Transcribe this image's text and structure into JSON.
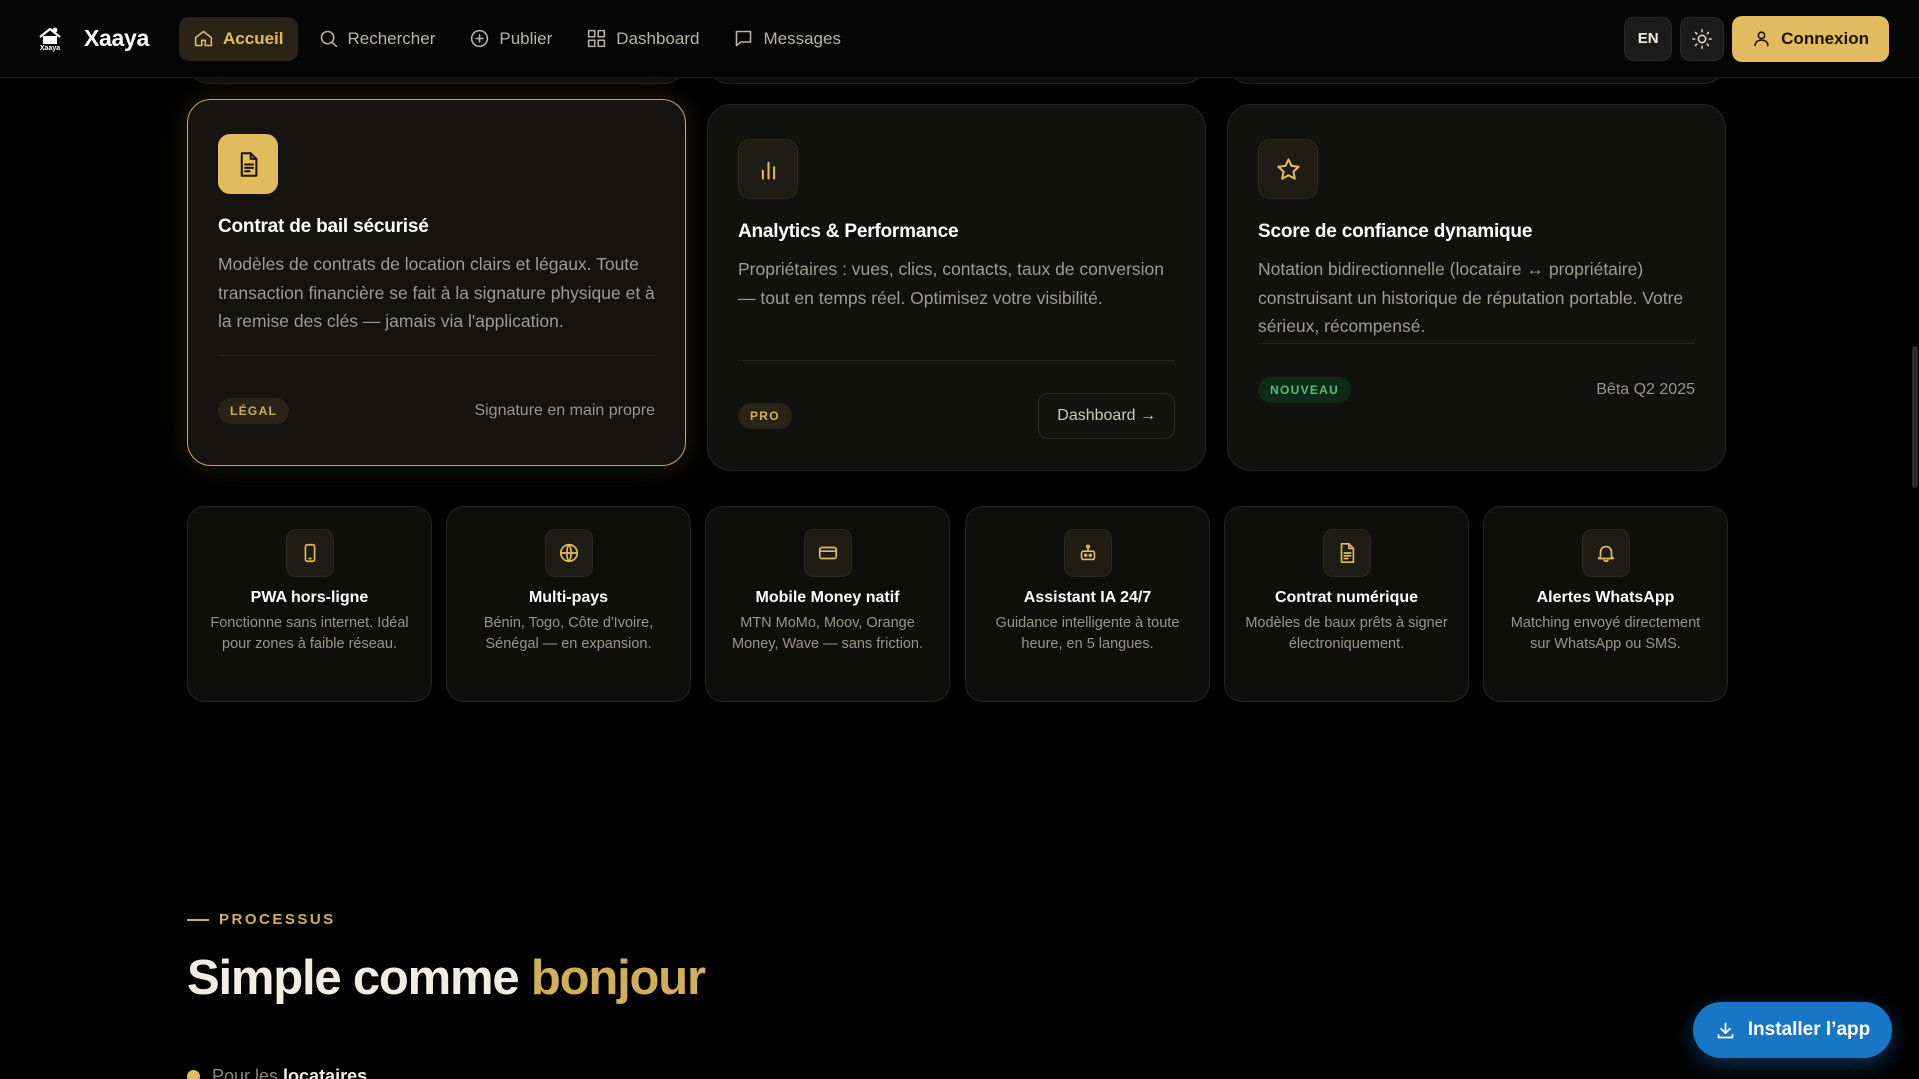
{
  "brand": {
    "logo_text": "Xaaya",
    "name": "Xaaya"
  },
  "nav": {
    "items": [
      {
        "label": "Accueil",
        "icon": "home-icon",
        "active": true
      },
      {
        "label": "Rechercher",
        "icon": "search-icon",
        "active": false
      },
      {
        "label": "Publier",
        "icon": "plus-circle-icon",
        "active": false
      },
      {
        "label": "Dashboard",
        "icon": "grid-icon",
        "active": false
      },
      {
        "label": "Messages",
        "icon": "message-icon",
        "active": false
      }
    ],
    "lang": "EN",
    "theme_icon": "sun-icon",
    "login_label": "Connexion"
  },
  "feature_cards": [
    {
      "icon": "document-icon",
      "title": "Contrat de bail sécurisé",
      "description": "Modèles de contrats de location clairs et légaux. Toute transaction financière se fait à la signature physique et à la remise des clés — jamais via l'application.",
      "badge": "LÉGAL",
      "footer": "Signature en main propre"
    },
    {
      "icon": "bar-chart-icon",
      "title": "Analytics & Performance",
      "description": "Propriétaires : vues, clics, contacts, taux de conversion — tout en temps réel. Optimisez votre visibilité.",
      "badge": "PRO",
      "footer_button": "Dashboard →"
    },
    {
      "icon": "star-icon",
      "title": "Score de confiance dynamique",
      "description": "Notation bidirectionnelle (locataire ↔ propriétaire) construisant un historique de réputation portable. Votre sérieux, récompensé.",
      "badge": "NOUVEAU",
      "footer": "Bêta Q2 2025"
    }
  ],
  "mini_features": [
    {
      "icon": "phone-icon",
      "title": "PWA hors-ligne",
      "description": "Fonctionne sans internet. Idéal pour zones à faible réseau."
    },
    {
      "icon": "globe-icon",
      "title": "Multi-pays",
      "description": "Bénin, Togo, Côte d'Ivoire, Sénégal — en expansion."
    },
    {
      "icon": "card-icon",
      "title": "Mobile Money natif",
      "description": "MTN MoMo, Moov, Orange Money, Wave — sans friction."
    },
    {
      "icon": "robot-icon",
      "title": "Assistant IA 24/7",
      "description": "Guidance intelligente à toute heure, en 5 langues."
    },
    {
      "icon": "document-icon",
      "title": "Contrat numérique",
      "description": "Modèles de baux prêts à signer électroniquement."
    },
    {
      "icon": "bell-icon",
      "title": "Alertes WhatsApp",
      "description": "Matching envoyé directement sur WhatsApp ou SMS."
    }
  ],
  "process": {
    "eyebrow": "PROCESSUS",
    "title_main": "Simple comme ",
    "title_accent": "bonjour",
    "sub_prefix": "Pour les ",
    "sub_strong": "locataires"
  },
  "install": {
    "label": "Installer l’app",
    "icon": "download-icon"
  },
  "colors": {
    "accent": "#e2bb5e",
    "background": "#000000",
    "install_blue": "#1876c7",
    "badge_green": "#4cc177"
  }
}
